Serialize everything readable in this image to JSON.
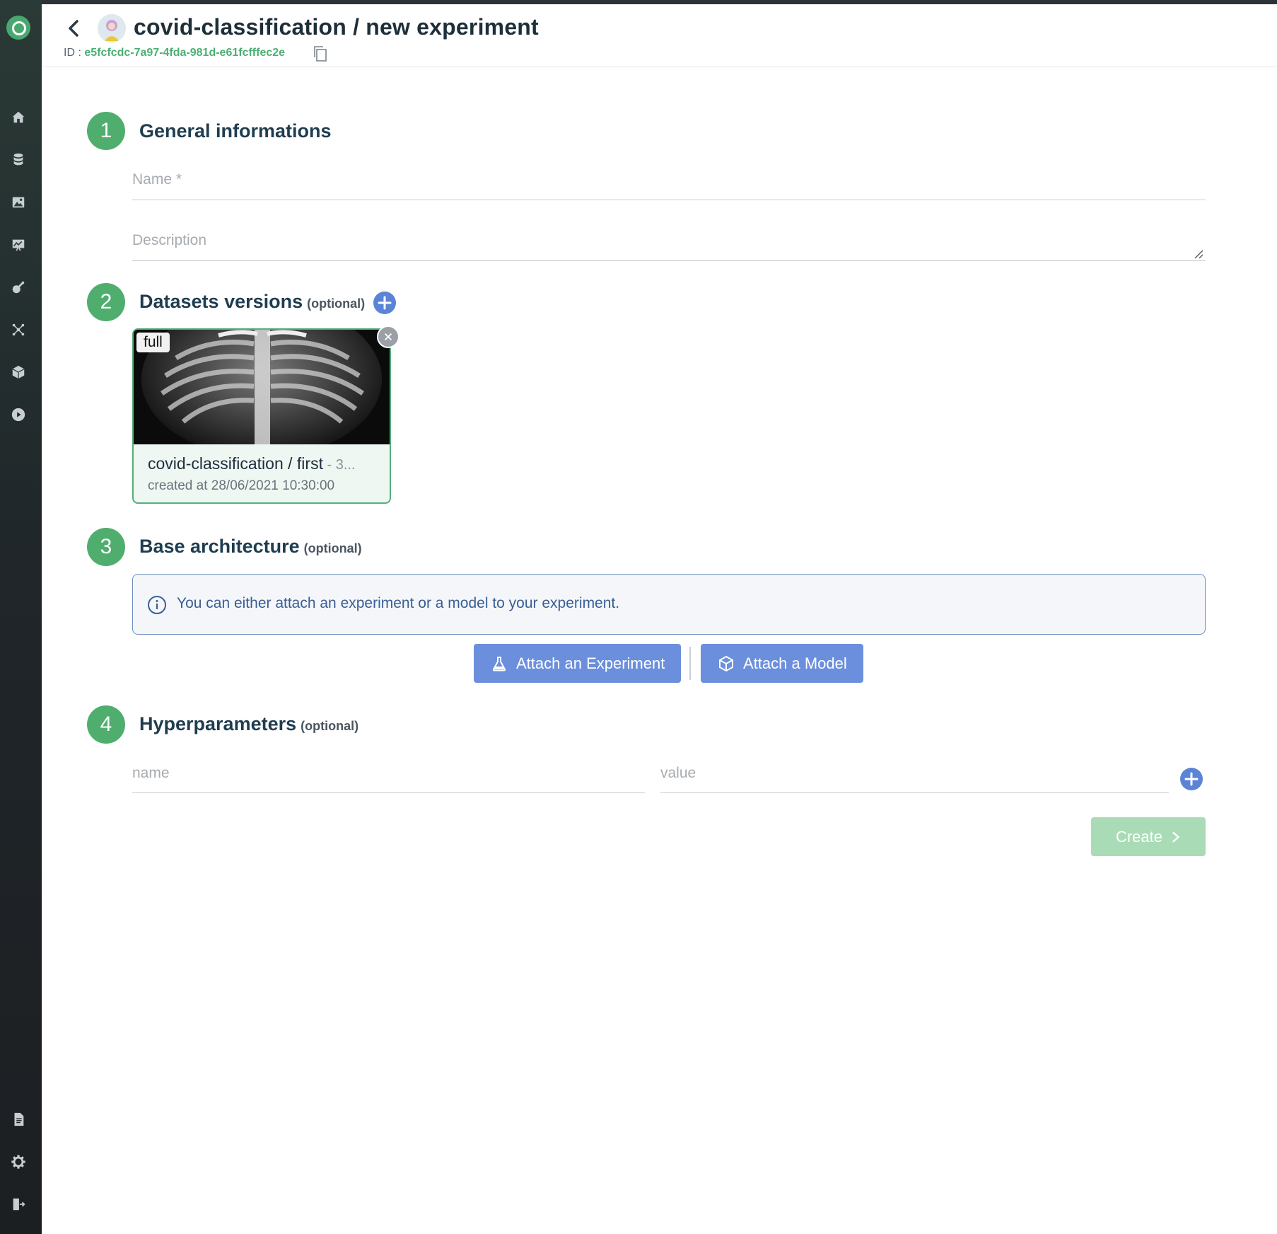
{
  "header": {
    "title": "covid-classification / new experiment",
    "id_label": "ID : ",
    "id_value": "e5fcfcdc-7a97-4fda-981d-e61fcfffec2e"
  },
  "steps": [
    {
      "number": "1",
      "title": "General informations",
      "optional": ""
    },
    {
      "number": "2",
      "title": "Datasets versions",
      "optional": "(optional)"
    },
    {
      "number": "3",
      "title": "Base architecture",
      "optional": "(optional)"
    },
    {
      "number": "4",
      "title": "Hyperparameters",
      "optional": "(optional)"
    }
  ],
  "general": {
    "name_placeholder": "Name *",
    "description_placeholder": "Description"
  },
  "dataset_card": {
    "tag": "full",
    "name": "covid-classification / first",
    "name_suffix": " - 3...",
    "created": "created at 28/06/2021 10:30:00"
  },
  "architecture": {
    "info": "You can either attach an experiment or a model to your experiment.",
    "attach_experiment": "Attach an Experiment",
    "attach_model": "Attach a Model"
  },
  "hyperparameters": {
    "name_placeholder": "name",
    "value_placeholder": "value"
  },
  "create_label": "Create",
  "colors": {
    "accent_green": "#4fae6e",
    "accent_blue": "#6b8fdc",
    "sidebar_bg": "#1c1f22"
  },
  "sidebar_icons": [
    "home-icon",
    "database-icon",
    "image-icon",
    "chart-icon",
    "flask-icon",
    "network-icon",
    "cube-icon",
    "play-icon",
    "document-icon",
    "gear-icon",
    "logout-icon"
  ]
}
